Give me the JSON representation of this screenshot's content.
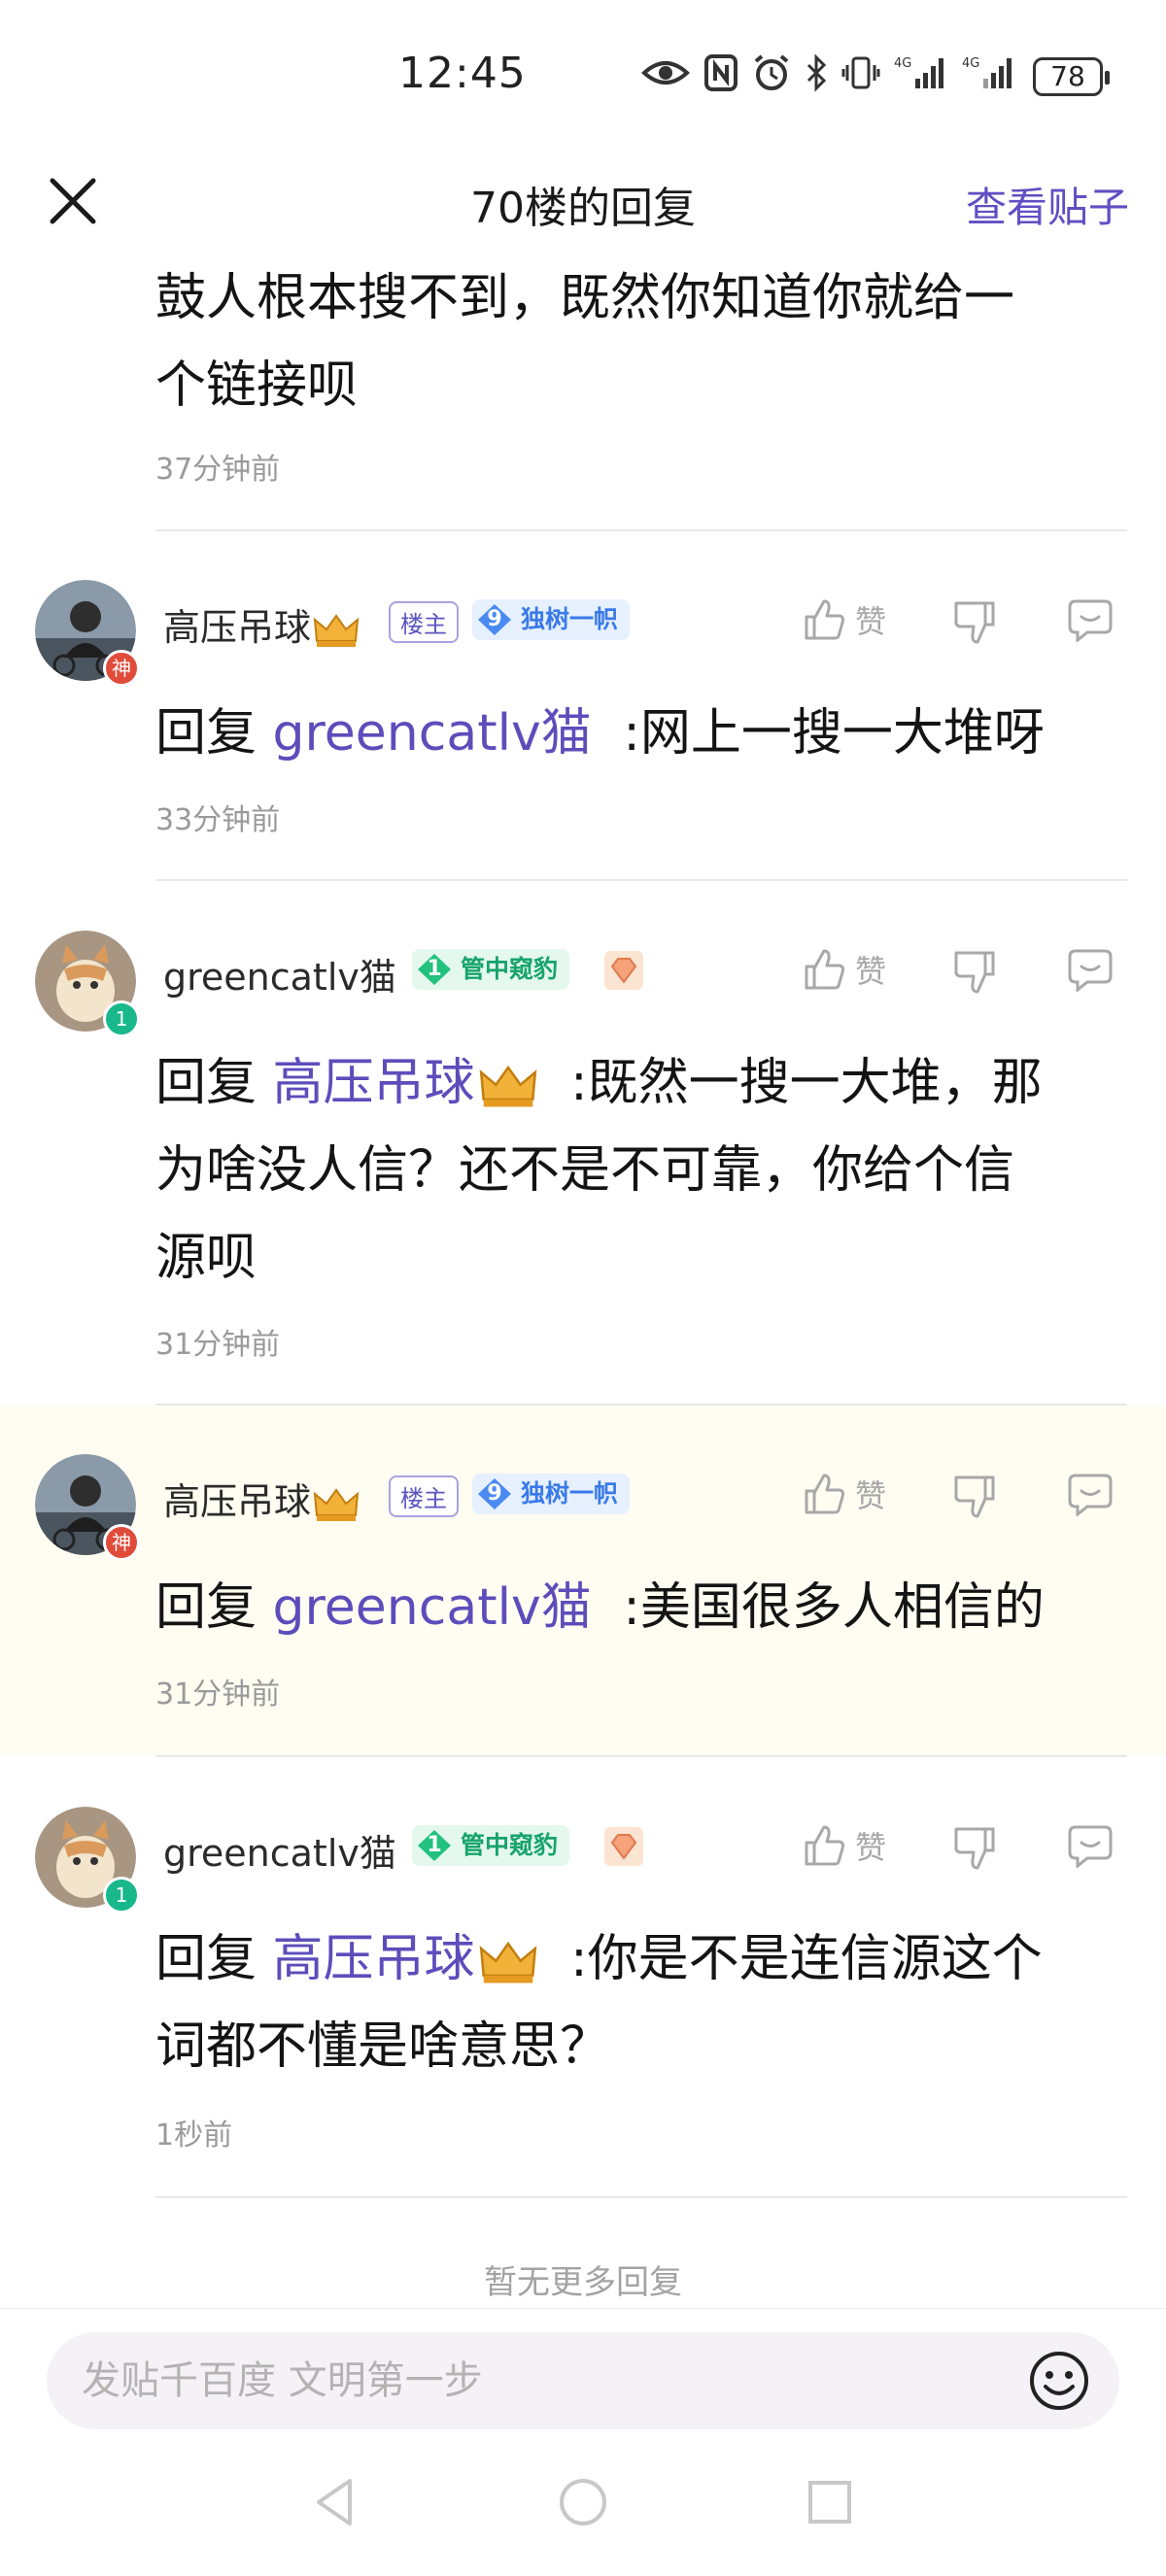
{
  "status_bar": {
    "time": "12:45",
    "battery": "78",
    "network_1": "4G",
    "network_2": "4G"
  },
  "header": {
    "title": "70楼的回复",
    "view_post": "查看贴子"
  },
  "top_fragment": {
    "text": "鼓人根本搜不到，既然你知道你就给一个链接呗",
    "line1": "鼓人根本搜不到，既然你知道你就给一",
    "line2": "个链接呗",
    "time": "37分钟前"
  },
  "replies": [
    {
      "username": "高压吊球",
      "host_tag": "楼主",
      "rank_level": "9",
      "rank_title": "独树一帜",
      "reply_prefix": "回复",
      "mention": "greencatlv猫",
      "lines": [
        ":网上一搜一大堆呀"
      ],
      "time": "33分钟前",
      "like_label": "赞"
    },
    {
      "username": "greencatlv猫",
      "rank_level": "1",
      "rank_title": "管中窥豹",
      "reply_prefix": "回复",
      "mention": "高压吊球",
      "lines": [
        ":既然一搜一大堆，那",
        "为啥没人信？还不是不可靠，你给个信",
        "源呗"
      ],
      "time": "31分钟前",
      "like_label": "赞"
    },
    {
      "username": "高压吊球",
      "host_tag": "楼主",
      "rank_level": "9",
      "rank_title": "独树一帜",
      "reply_prefix": "回复",
      "mention": "greencatlv猫",
      "lines": [
        ":美国很多人相信的"
      ],
      "time": "31分钟前",
      "like_label": "赞"
    },
    {
      "username": "greencatlv猫",
      "rank_level": "1",
      "rank_title": "管中窥豹",
      "reply_prefix": "回复",
      "mention": "高压吊球",
      "lines": [
        ":你是不是连信源这个",
        "词都不懂是啥意思？"
      ],
      "time": "1秒前",
      "like_label": "赞"
    }
  ],
  "avatar_badges": {
    "god": "神",
    "level": "1"
  },
  "no_more": "暂无更多回复",
  "input": {
    "placeholder": "发贴千百度 文明第一步"
  },
  "colors": {
    "accent": "#614ec4",
    "mention": "#5d4dbb",
    "highlight_bg": "#fffdf2"
  },
  "icons": [
    "close-icon",
    "thumbs-up-icon",
    "thumbs-down-icon",
    "comment-icon",
    "emoji-icon",
    "crown-icon",
    "gem-icon",
    "back-nav-icon",
    "home-nav-icon",
    "recents-nav-icon"
  ]
}
